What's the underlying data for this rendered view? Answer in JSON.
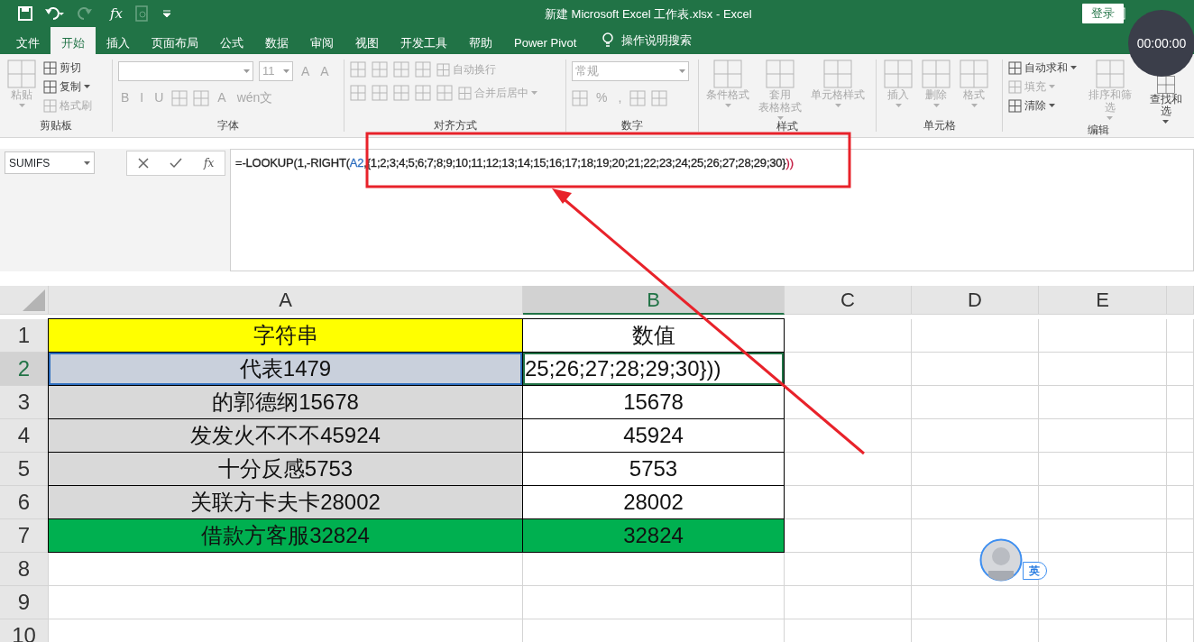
{
  "window": {
    "title": "新建 Microsoft Excel 工作表.xlsx  -  Excel",
    "login": "登录"
  },
  "quick_access": {
    "function": "fx"
  },
  "tabs": [
    {
      "label": "文件",
      "selected": false
    },
    {
      "label": "开始",
      "selected": true
    },
    {
      "label": "插入",
      "selected": false
    },
    {
      "label": "页面布局",
      "selected": false
    },
    {
      "label": "公式",
      "selected": false
    },
    {
      "label": "数据",
      "selected": false
    },
    {
      "label": "审阅",
      "selected": false
    },
    {
      "label": "视图",
      "selected": false
    },
    {
      "label": "开发工具",
      "selected": false
    },
    {
      "label": "帮助",
      "selected": false
    },
    {
      "label": "Power Pivot",
      "selected": false
    }
  ],
  "tell_me": "操作说明搜索",
  "ribbon": [
    {
      "label": "剪贴板",
      "columns": [
        [
          {
            "kind": "large",
            "lines": [
              "粘贴"
            ],
            "disabled": true,
            "dropdown": true
          }
        ],
        [
          {
            "kind": "small",
            "label": "剪切",
            "disabled": false,
            "dropdown": false
          },
          {
            "kind": "small",
            "label": "复制",
            "disabled": false,
            "dropdown": true
          },
          {
            "kind": "small",
            "label": "格式刷",
            "disabled": true,
            "dropdown": false
          }
        ]
      ]
    },
    {
      "label": "字体",
      "rows": [
        {
          "items": [
            {
              "kind": "combo",
              "wide": true,
              "disabled": true
            },
            {
              "kind": "combo",
              "value": "11",
              "wide": false,
              "disabled": true
            },
            {
              "kind": "glyph",
              "label": "A",
              "disabled": true
            },
            {
              "kind": "glyph",
              "label": "A",
              "disabled": true
            }
          ]
        },
        {
          "items": [
            {
              "kind": "glyph",
              "label": "B",
              "disabled": true
            },
            {
              "kind": "glyph",
              "label": "I",
              "disabled": true
            },
            {
              "kind": "glyph",
              "label": "U",
              "disabled": true
            },
            {
              "kind": "icon",
              "disabled": true
            },
            {
              "kind": "icon",
              "disabled": true
            },
            {
              "kind": "glyph",
              "label": "A",
              "disabled": true
            },
            {
              "kind": "glyph",
              "label": "wén文",
              "disabled": true
            }
          ]
        }
      ]
    },
    {
      "label": "对齐方式",
      "rows": [
        {
          "items": [
            {
              "kind": "icon",
              "disabled": true
            },
            {
              "kind": "icon",
              "disabled": true
            },
            {
              "kind": "icon",
              "disabled": true
            },
            {
              "kind": "icon",
              "disabled": true
            },
            {
              "kind": "small",
              "label": "自动换行",
              "disabled": true,
              "dropdown": false
            }
          ]
        },
        {
          "items": [
            {
              "kind": "icon",
              "disabled": true
            },
            {
              "kind": "icon",
              "disabled": true
            },
            {
              "kind": "icon",
              "disabled": true
            },
            {
              "kind": "icon",
              "disabled": true
            },
            {
              "kind": "icon",
              "disabled": true
            },
            {
              "kind": "small",
              "label": "合并后居中",
              "disabled": true,
              "dropdown": true
            }
          ]
        }
      ]
    },
    {
      "label": "数字",
      "rows": [
        {
          "items": [
            {
              "kind": "combo",
              "value": "常规",
              "wide": true,
              "disabled": true
            }
          ]
        },
        {
          "items": [
            {
              "kind": "icon",
              "disabled": true
            },
            {
              "kind": "glyph",
              "label": "%",
              "disabled": true
            },
            {
              "kind": "glyph",
              "label": ",",
              "disabled": true
            },
            {
              "kind": "icon",
              "disabled": true
            },
            {
              "kind": "icon",
              "disabled": true
            }
          ]
        }
      ]
    },
    {
      "label": "样式",
      "columns": [
        [
          {
            "kind": "large",
            "lines": [
              "条件格式"
            ],
            "disabled": true,
            "dropdown": true
          }
        ],
        [
          {
            "kind": "large",
            "lines": [
              "套用",
              "表格格式"
            ],
            "disabled": true,
            "dropdown": true
          }
        ],
        [
          {
            "kind": "large",
            "lines": [
              "单元格样式"
            ],
            "disabled": true,
            "dropdown": true
          }
        ]
      ]
    },
    {
      "label": "单元格",
      "columns": [
        [
          {
            "kind": "large",
            "lines": [
              "插入"
            ],
            "disabled": true,
            "dropdown": true
          }
        ],
        [
          {
            "kind": "large",
            "lines": [
              "删除"
            ],
            "disabled": true,
            "dropdown": true
          }
        ],
        [
          {
            "kind": "large",
            "lines": [
              "格式"
            ],
            "disabled": true,
            "dropdown": true
          }
        ]
      ]
    },
    {
      "label": "编辑",
      "columns": [
        [
          {
            "kind": "small",
            "label": "自动求和",
            "disabled": false,
            "dropdown": true
          },
          {
            "kind": "small",
            "label": "填充",
            "disabled": true,
            "dropdown": true
          },
          {
            "kind": "small",
            "label": "清除",
            "disabled": false,
            "dropdown": true
          }
        ],
        [
          {
            "kind": "large",
            "lines": [
              "排序和筛选"
            ],
            "disabled": true,
            "dropdown": true
          }
        ],
        [
          {
            "kind": "large",
            "lines": [
              "查找和选"
            ],
            "disabled": false,
            "dropdown": true
          }
        ]
      ]
    }
  ],
  "formula_bar": {
    "name_box": "SUMIFS",
    "function": "fx",
    "formula": [
      {
        "text": "=-LOOKUP(1,-RIGHT(",
        "color": "#222222"
      },
      {
        "text": "A2",
        "color": "#2e6ebf"
      },
      {
        "text": ",{1;2;3;4;5;6;7;8;9;10;11;12;13;14;15;16;17;18;19;20;21;22;23;24;25;26;27;28;29;30}",
        "color": "#222222"
      },
      {
        "text": "))",
        "color": "#c0143c"
      }
    ]
  },
  "sheet": {
    "columns": [
      {
        "label": "A",
        "selected": false
      },
      {
        "label": "B",
        "selected": true
      },
      {
        "label": "C",
        "selected": false
      },
      {
        "label": "D",
        "selected": false
      },
      {
        "label": "E",
        "selected": false
      }
    ],
    "rows": [
      {
        "label": "1",
        "selected": false,
        "cells": [
          {
            "text": "字符串",
            "color": "#ffff00",
            "editing": false,
            "referenced": false
          },
          {
            "text": "数值",
            "color": "#ffffff",
            "editing": false,
            "referenced": false
          }
        ]
      },
      {
        "label": "2",
        "selected": true,
        "cells": [
          {
            "text": "代表1479",
            "color": "#c9d0dc",
            "editing": false,
            "referenced": true
          },
          {
            "text": "25;26;27;28;29;30}))",
            "color": "#ffffff",
            "editing": true,
            "referenced": false
          }
        ]
      },
      {
        "label": "3",
        "selected": false,
        "cells": [
          {
            "text": "的郭德纲15678",
            "color": "#d9d9d9",
            "editing": false,
            "referenced": false
          },
          {
            "text": "15678",
            "color": "#ffffff",
            "editing": false,
            "referenced": false
          }
        ]
      },
      {
        "label": "4",
        "selected": false,
        "cells": [
          {
            "text": "发发火不不不45924",
            "color": "#d9d9d9",
            "editing": false,
            "referenced": false
          },
          {
            "text": "45924",
            "color": "#ffffff",
            "editing": false,
            "referenced": false
          }
        ]
      },
      {
        "label": "5",
        "selected": false,
        "cells": [
          {
            "text": "十分反感5753",
            "color": "#d9d9d9",
            "editing": false,
            "referenced": false
          },
          {
            "text": "5753",
            "color": "#ffffff",
            "editing": false,
            "referenced": false
          }
        ]
      },
      {
        "label": "6",
        "selected": false,
        "cells": [
          {
            "text": "关联方卡夫卡28002",
            "color": "#d9d9d9",
            "editing": false,
            "referenced": false
          },
          {
            "text": "28002",
            "color": "#ffffff",
            "editing": false,
            "referenced": false
          }
        ]
      },
      {
        "label": "7",
        "selected": false,
        "cells": [
          {
            "text": "借款方客服32824",
            "color": "#00b050",
            "editing": false,
            "referenced": false
          },
          {
            "text": "32824",
            "color": "#00b050",
            "editing": false,
            "referenced": false
          }
        ]
      },
      {
        "label": "8",
        "selected": false,
        "cells": []
      },
      {
        "label": "9",
        "selected": false,
        "cells": []
      },
      {
        "label": "10",
        "selected": false,
        "cells": []
      }
    ]
  },
  "recorder_timer": "00:00:00",
  "ime_indicator": "英"
}
